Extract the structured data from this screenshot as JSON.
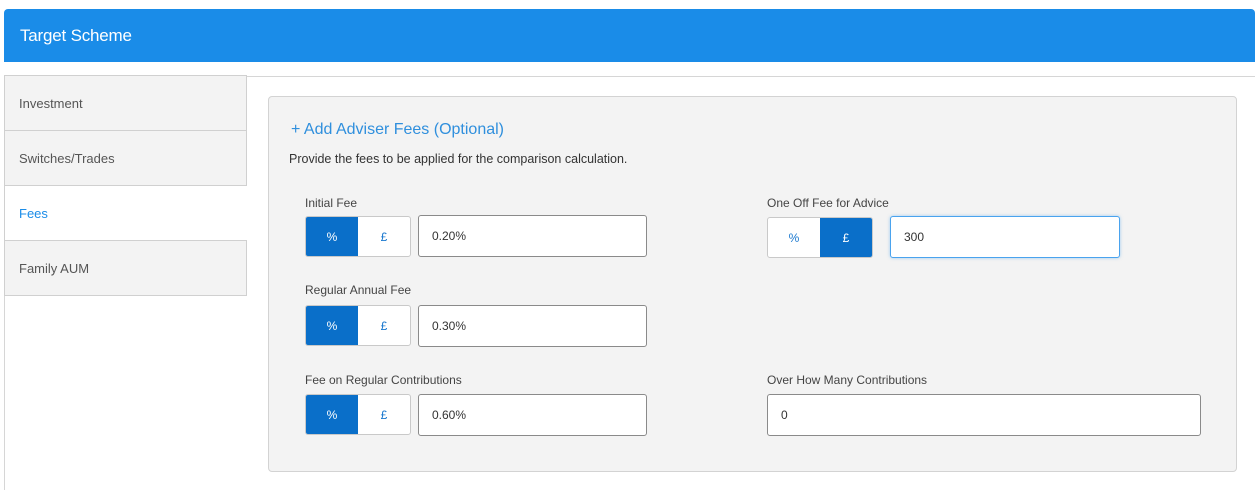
{
  "header": {
    "title": "Target Scheme"
  },
  "tabs": [
    {
      "label": "Investment"
    },
    {
      "label": "Switches/Trades"
    },
    {
      "label": "Fees"
    },
    {
      "label": "Family AUM"
    }
  ],
  "active_tab": "Fees",
  "panel": {
    "add_link": "+ Add Adviser Fees (Optional)",
    "description": "Provide the fees to be applied for the comparison calculation.",
    "toggle_options": {
      "percent": "%",
      "pound": "£"
    },
    "initial_fee": {
      "label": "Initial Fee",
      "selected": "%",
      "value": "0.20%"
    },
    "one_off_fee": {
      "label": "One Off Fee for Advice",
      "selected": "£",
      "value": "300"
    },
    "regular_annual_fee": {
      "label": "Regular Annual Fee",
      "selected": "%",
      "value": "0.30%"
    },
    "fee_regular_contributions": {
      "label": "Fee on Regular Contributions",
      "selected": "%",
      "value": "0.60%"
    },
    "over_how_many": {
      "label": "Over How Many Contributions",
      "value": "0"
    }
  },
  "colors": {
    "header": "#1a8ce8",
    "selected_toggle": "#0a6fc9",
    "link": "#2f8fdd"
  }
}
